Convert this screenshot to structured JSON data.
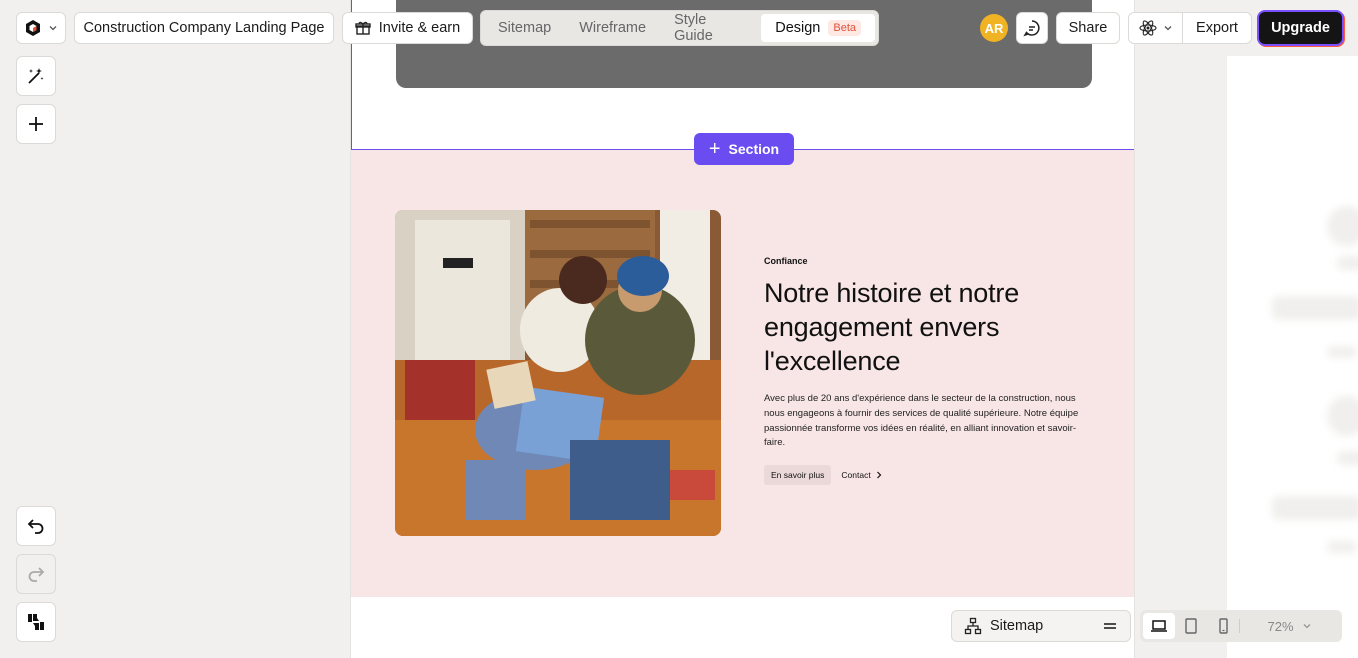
{
  "top_bar": {
    "project_title": "Construction Company Landing Page",
    "invite_label": "Invite & earn",
    "tabs": [
      {
        "label": "Sitemap"
      },
      {
        "label": "Wireframe"
      },
      {
        "label": "Style Guide"
      },
      {
        "label": "Design",
        "badge": "Beta",
        "active": true
      }
    ],
    "avatar_initials": "AR",
    "share_label": "Share",
    "export_label": "Export",
    "upgrade_label": "Upgrade"
  },
  "canvas": {
    "section_button_label": "Section",
    "hero": {
      "eyebrow": "Confiance",
      "heading": "Notre histoire et notre engagement envers l'excellence",
      "body": "Avec plus de 20 ans d'expérience dans le secteur de la construction, nous nous engageons à fournir des services de qualité supérieure. Notre équipe passionnée transforme vos idées en réalité, en alliant innovation et savoir-faire.",
      "primary_cta": "En savoir plus",
      "secondary_cta": "Contact"
    }
  },
  "bottom_bar": {
    "sitemap_label": "Sitemap",
    "zoom": "72%"
  },
  "colors": {
    "accent": "#6a4cf0",
    "hero_bg": "#f8e6e6",
    "avatar_bg": "#f0b323",
    "beta": "#e0513a"
  },
  "icons": [
    "app-logo-icon",
    "chevron-down-icon",
    "gift-icon",
    "comment-icon",
    "react-icon",
    "magic-wand-icon",
    "plus-icon",
    "undo-icon",
    "redo-icon",
    "feedback-icon",
    "sitemap-icon",
    "menu-icon",
    "desktop-icon",
    "tablet-icon",
    "mobile-icon"
  ]
}
